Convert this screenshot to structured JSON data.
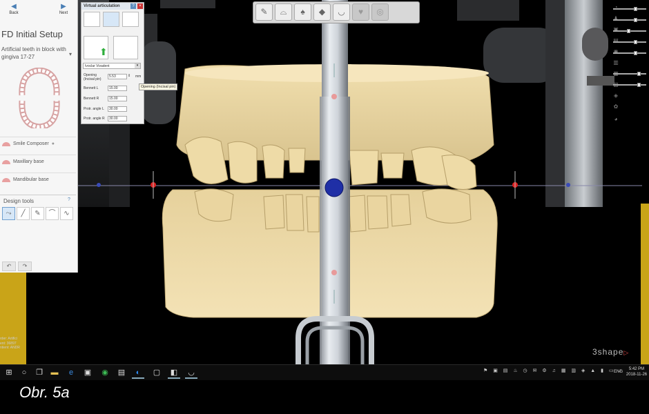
{
  "nav": {
    "back_label": "Back",
    "next_label": "Next"
  },
  "setup": {
    "title": "FD Initial Setup",
    "subtitle": "Artificial teeth in block with gingiva 17-27"
  },
  "menu": [
    {
      "label": "Smile Composer",
      "icon": "smile-icon"
    },
    {
      "label": "Maxillary base",
      "icon": "maxillary-icon"
    },
    {
      "label": "Mandibular base",
      "icon": "mandibular-icon"
    }
  ],
  "design_tools": {
    "label": "Design tools",
    "help": "?",
    "tools": [
      "pointer-tool-icon",
      "knife-tool-icon",
      "wax-tool-icon",
      "sculpt-tool-icon",
      "smooth-tool-icon"
    ]
  },
  "virtual_articulation": {
    "title": "Virtual articulation",
    "articulator": "Ivoclar Vivadent",
    "opening_label": "Opening (Incisal pin)",
    "opening_value": "5.53",
    "opening_unit": "mm",
    "bennett_l_label": "Bennett L",
    "bennett_l_value": "15.00",
    "bennett_r_label": "Bennett R",
    "bennett_r_value": "15.00",
    "protr_l_label": "Protr. angle L",
    "protr_l_value": "30.00",
    "protr_r_label": "Protr. angle R",
    "protr_r_value": "30.00",
    "tooltip": "Opening (Incisal pin)"
  },
  "order": {
    "line1_label": "rder:",
    "line1_value": "Artifici",
    "line2_label": "ent:",
    "line2_value": "36897",
    "line3_label": "ntient:",
    "line3_value": "ANDR"
  },
  "logo": "3shape",
  "taskbar": {
    "lang": "ENG",
    "time": "5:42 PM",
    "date": "2018-11-26"
  },
  "caption": "Obr. 5a",
  "colors": {
    "model": "#f0dcac",
    "background": "#000000",
    "accent": "#4a7fb5"
  }
}
